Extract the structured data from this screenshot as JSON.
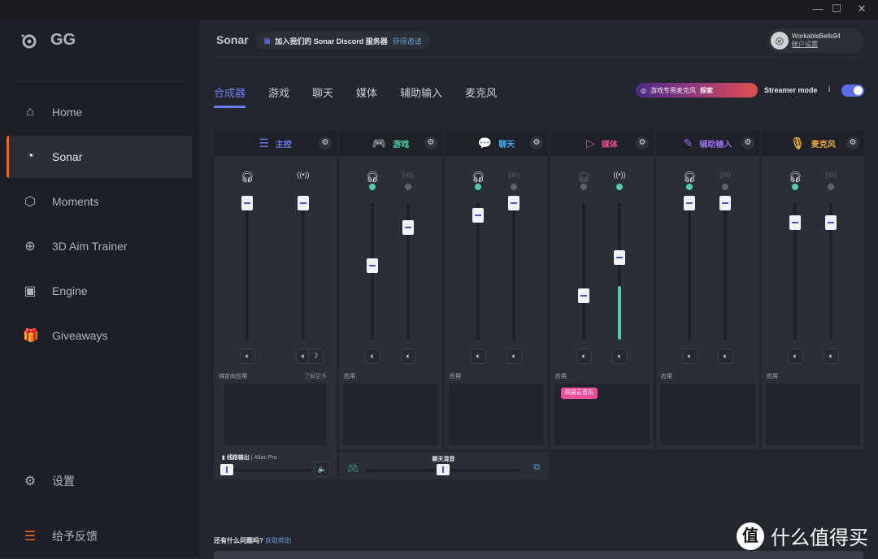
{
  "window": {
    "minimize": "—",
    "maximize": "☐",
    "close": "✕"
  },
  "sidebar": {
    "logo": "GG",
    "items": [
      {
        "label": "Home",
        "icon": "home-icon",
        "glyph": "⌂"
      },
      {
        "label": "Sonar",
        "icon": "sonar-icon",
        "glyph": "◔",
        "active": true
      },
      {
        "label": "Moments",
        "icon": "hexagon-icon",
        "glyph": "⬡"
      },
      {
        "label": "3D Aim Trainer",
        "icon": "crosshair-icon",
        "glyph": "⊕"
      },
      {
        "label": "Engine",
        "icon": "chip-icon",
        "glyph": "▣"
      },
      {
        "label": "Giveaways",
        "icon": "gift-icon",
        "glyph": "🎁"
      }
    ],
    "settings": "设置",
    "feedback": "给予反馈"
  },
  "header": {
    "title": "Sonar",
    "discord_text": "加入我们的 Sonar Discord 服务器",
    "discord_link": "获得邀请",
    "user_name": "WorkableBells94",
    "account_settings": "帐户设置"
  },
  "tabs": [
    {
      "label": "合成器",
      "active": true
    },
    {
      "label": "游戏"
    },
    {
      "label": "聊天"
    },
    {
      "label": "媒体"
    },
    {
      "label": "辅助输入"
    },
    {
      "label": "麦克风"
    }
  ],
  "promo": {
    "text": "游戏专用麦克风",
    "link": "探索"
  },
  "streamer_mode": {
    "label": "Streamer mode",
    "info": "i",
    "enabled": true
  },
  "channels": [
    {
      "name": "主控",
      "color": "#6c7ff0",
      "icon": "sliders-icon",
      "glyph": "☰",
      "master": true,
      "app_label": "待定向应用",
      "app_link": "了解更多",
      "sliders": [
        {
          "device": "headphone",
          "on": true,
          "level": 100
        },
        {
          "device": "broadcast",
          "on": true,
          "level": 100
        }
      ]
    },
    {
      "name": "游戏",
      "color": "#4fd1a5",
      "icon": "gamepad-icon",
      "glyph": "🎮",
      "app_label": "应用",
      "sliders": [
        {
          "device": "headphone",
          "on": true,
          "level": 54
        },
        {
          "device": "broadcast",
          "on": false,
          "level": 82
        }
      ]
    },
    {
      "name": "聊天",
      "color": "#4aa8e8",
      "icon": "chat-icon",
      "glyph": "💬",
      "app_label": "应用",
      "sliders": [
        {
          "device": "headphone",
          "on": true,
          "level": 91
        },
        {
          "device": "broadcast",
          "on": false,
          "level": 100
        }
      ]
    },
    {
      "name": "媒体",
      "color": "#e84e9a",
      "icon": "play-icon",
      "glyph": "▷",
      "app_label": "应用",
      "apps": [
        "网易云音乐"
      ],
      "sliders": [
        {
          "device": "headphone",
          "on": false,
          "level": 32
        },
        {
          "device": "broadcast",
          "on": true,
          "level": 60,
          "meter": 39
        }
      ]
    },
    {
      "name": "辅助输入",
      "color": "#9b6cf0",
      "icon": "aux-cable-icon",
      "glyph": "✎",
      "app_label": "应用",
      "sliders": [
        {
          "device": "headphone",
          "on": true,
          "level": 100
        },
        {
          "device": "broadcast",
          "on": false,
          "level": 100
        }
      ]
    },
    {
      "name": "麦克风",
      "color": "#f0a83c",
      "icon": "microphone-icon",
      "glyph": "🎙",
      "app_label": "应用",
      "sliders": [
        {
          "device": "headphone",
          "on": true,
          "level": 86
        },
        {
          "device": "broadcast",
          "on": false,
          "level": 86
        }
      ]
    }
  ],
  "line_out": {
    "label": "线路输出",
    "device": "Alias Pro",
    "level": 5
  },
  "chat_mix": {
    "label": "聊天混音",
    "level": 50
  },
  "help": {
    "text": "还有什么问题吗?",
    "link": "获取帮助"
  },
  "watermark": {
    "mark": "值",
    "text": "什么值得买"
  }
}
